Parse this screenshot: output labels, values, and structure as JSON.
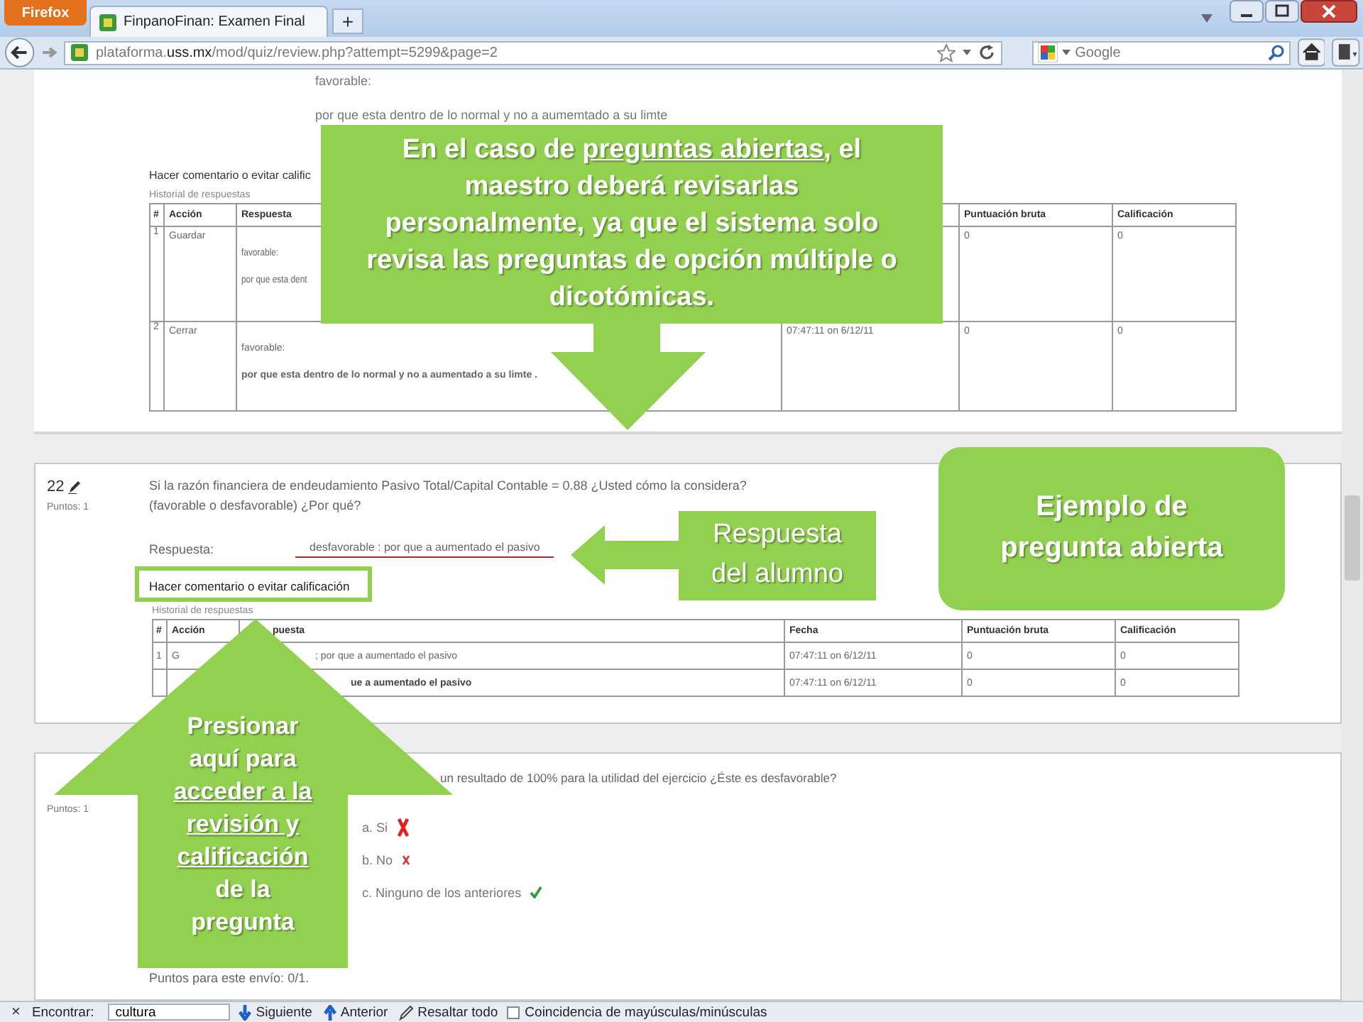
{
  "browser": {
    "menu_button": "Firefox",
    "tab": {
      "title": "FinpanoFinan: Examen Final",
      "selected": true
    },
    "new_tab": "+",
    "url": "plataforma.**uss.mx**/mod/quiz/review.php?attempt=5299&page=2",
    "search_placeholder": "Google"
  },
  "previous_question": {
    "answer_lines": [
      "favorable:",
      "por que  esta dentro de lo normal y no a aumemtado a su limte"
    ],
    "comment_link": "Hacer comentario o evitar calific",
    "history_title": "Historial de respuestas",
    "table": {
      "columns": [
        "#",
        "Acción",
        "Respuesta",
        null,
        "Puntuación bruta",
        "Calificación"
      ],
      "rows": [
        {
          "bold": false,
          "cells": [
            "1",
            "Guardar",
            [
              "favorable:",
              "por que  esta dent"
            ],
            null,
            "0",
            "0"
          ]
        },
        {
          "bold": true,
          "cells": [
            "2",
            "Cerrar",
            [
              "favorable:",
              "por que  esta dentro de lo normal y no a aumentado a su limte ."
            ],
            "07:47:11 on 6/12/11",
            "0",
            "0"
          ]
        }
      ]
    }
  },
  "question_22": {
    "number": "22",
    "points": "Puntos: 1",
    "text_lines": [
      "Si la razón financiera de endeudamiento Pasivo Total/Capital Contable = 0.88 ¿Usted cómo la considera?",
      "(favorable o desfavorable) ¿Por qué?"
    ],
    "answer_label": "Respuesta:",
    "answer": "desfavorable : por que a aumentado el pasivo",
    "comment_link": "Hacer comentario o evitar calificación",
    "history_title": "Historial de respuestas",
    "table": {
      "columns": [
        "#",
        "Acción",
        "puesta",
        "Fecha",
        "Puntuación bruta",
        "Calificación"
      ],
      "rows": [
        {
          "bold": false,
          "cells": [
            "1",
            "G",
            "; por que a aumentado el pasivo",
            "07:47:11 on 6/12/11",
            "0",
            "0"
          ]
        },
        {
          "bold": true,
          "cells": [
            null,
            null,
            "ue a aumentado el pasivo",
            "07:47:11 on 6/12/11",
            "0",
            "0"
          ]
        }
      ]
    }
  },
  "question_23": {
    "points": "Puntos: 1",
    "text": "un resultado de 100% para la utilidad del ejercicio ¿Éste es desfavorable?",
    "options": [
      {
        "label": "a. Si",
        "correct": false,
        "selected": true
      },
      {
        "label": "b. No",
        "correct": false,
        "selected": false
      },
      {
        "label": "c. Ninguno de los anteriores",
        "correct": true,
        "selected": false
      }
    ],
    "score": "Puntos para este envío: 0/1."
  },
  "callouts": [
    {
      "kind": "box_arrow_down",
      "parts": [
        {
          "text": "En el caso de ",
          "underline": false
        },
        {
          "text": "preguntas abiertas",
          "underline": true
        },
        {
          "text": ", el maestro deberá revisarlas personalmente, ya que el sistema solo revisa las preguntas de opción múltiple o dicotómicas.",
          "underline": false
        }
      ]
    },
    {
      "kind": "rounded",
      "parts": [
        {
          "text": "Ejemplo de pregunta abierta",
          "underline": false
        }
      ]
    },
    {
      "kind": "box_arrow_left",
      "parts": [
        {
          "text": "Respuesta del alumno",
          "underline": false
        }
      ]
    },
    {
      "kind": "arrow_up",
      "parts": [
        {
          "text": "Presionar aquí para ",
          "underline": false
        },
        {
          "text": "acceder a la revisión y calificación",
          "underline": true
        },
        {
          "text": " de la pregunta",
          "underline": false
        }
      ]
    }
  ],
  "find_bar": {
    "close": "×",
    "label": "Encontrar:",
    "value": "cultura",
    "next": "Siguiente",
    "previous": "Anterior",
    "highlight": "Resaltar todo",
    "match_case": {
      "label": "Coincidencia de mayúsculas/minúsculas",
      "checked": false
    }
  }
}
